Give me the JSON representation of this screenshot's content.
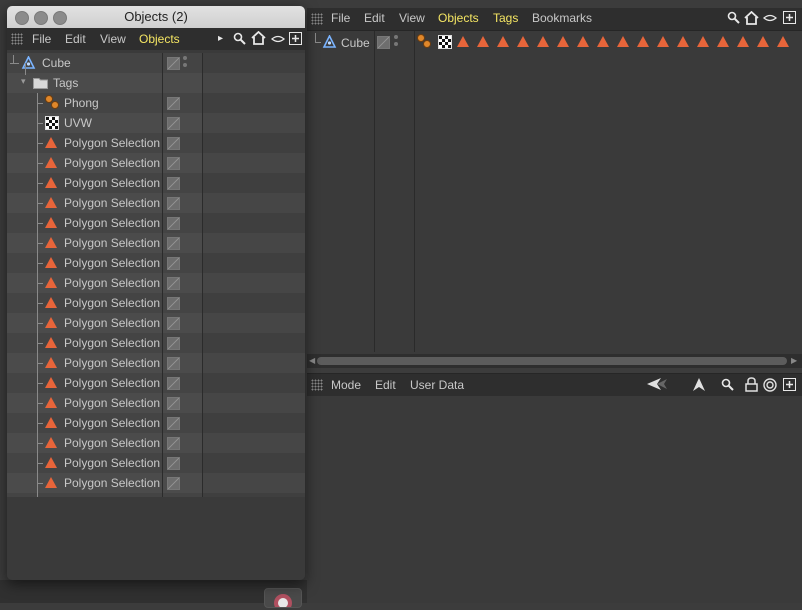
{
  "main_window": {
    "menubar": {
      "items": [
        {
          "label": "File",
          "highlight": false
        },
        {
          "label": "Edit",
          "highlight": false
        },
        {
          "label": "View",
          "highlight": false
        },
        {
          "label": "Objects",
          "highlight": true
        },
        {
          "label": "Tags",
          "highlight": true
        },
        {
          "label": "Bookmarks",
          "highlight": false
        }
      ],
      "icons": [
        "search-icon",
        "home-icon",
        "eye-icon",
        "new-panel-icon"
      ]
    },
    "object_row": {
      "name": "Cube",
      "tags": [
        "phong",
        "uvw",
        "polygon-selection",
        "polygon-selection",
        "polygon-selection",
        "polygon-selection",
        "polygon-selection",
        "polygon-selection",
        "polygon-selection",
        "polygon-selection",
        "polygon-selection",
        "polygon-selection",
        "polygon-selection",
        "polygon-selection",
        "polygon-selection",
        "polygon-selection",
        "polygon-selection",
        "polygon-selection",
        "polygon-selection"
      ]
    },
    "attributes": {
      "menubar": [
        "Mode",
        "Edit",
        "User Data"
      ],
      "icons": [
        "back-icon",
        "forward-icon",
        "up-arrow-icon",
        "search-icon",
        "lock-icon",
        "target-icon",
        "new-panel-icon"
      ]
    }
  },
  "floating_window": {
    "title": "Objects (2)",
    "menubar": [
      {
        "label": "File",
        "highlight": false
      },
      {
        "label": "Edit",
        "highlight": false
      },
      {
        "label": "View",
        "highlight": false
      },
      {
        "label": "Objects",
        "highlight": true
      }
    ],
    "tree": [
      {
        "label": "Cube",
        "kind": "cube",
        "depth": 0
      },
      {
        "label": "Tags",
        "kind": "folder",
        "depth": 1
      },
      {
        "label": "Phong",
        "kind": "phong",
        "depth": 2
      },
      {
        "label": "UVW",
        "kind": "uvw",
        "depth": 2
      },
      {
        "label": "Polygon Selection",
        "kind": "polygon-selection",
        "depth": 2
      },
      {
        "label": "Polygon Selection",
        "kind": "polygon-selection",
        "depth": 2
      },
      {
        "label": "Polygon Selection",
        "kind": "polygon-selection",
        "depth": 2
      },
      {
        "label": "Polygon Selection",
        "kind": "polygon-selection",
        "depth": 2
      },
      {
        "label": "Polygon Selection",
        "kind": "polygon-selection",
        "depth": 2
      },
      {
        "label": "Polygon Selection",
        "kind": "polygon-selection",
        "depth": 2
      },
      {
        "label": "Polygon Selection",
        "kind": "polygon-selection",
        "depth": 2
      },
      {
        "label": "Polygon Selection",
        "kind": "polygon-selection",
        "depth": 2
      },
      {
        "label": "Polygon Selection",
        "kind": "polygon-selection",
        "depth": 2
      },
      {
        "label": "Polygon Selection",
        "kind": "polygon-selection",
        "depth": 2
      },
      {
        "label": "Polygon Selection",
        "kind": "polygon-selection",
        "depth": 2
      },
      {
        "label": "Polygon Selection",
        "kind": "polygon-selection",
        "depth": 2
      },
      {
        "label": "Polygon Selection",
        "kind": "polygon-selection",
        "depth": 2
      },
      {
        "label": "Polygon Selection",
        "kind": "polygon-selection",
        "depth": 2
      },
      {
        "label": "Polygon Selection",
        "kind": "polygon-selection",
        "depth": 2
      },
      {
        "label": "Polygon Selection",
        "kind": "polygon-selection",
        "depth": 2
      },
      {
        "label": "Polygon Selection",
        "kind": "polygon-selection",
        "depth": 2
      },
      {
        "label": "Polygon Selection",
        "kind": "polygon-selection",
        "depth": 2
      },
      {
        "label": "Polygon Selection",
        "kind": "polygon-selection",
        "depth": 2
      }
    ]
  },
  "colors": {
    "highlight": "#f5e663",
    "tag_orange": "#e8653a",
    "panel_bg": "#3a3a3a",
    "menubar_bg": "#2e2e2e",
    "cube_blue": "#7ab4ff"
  }
}
